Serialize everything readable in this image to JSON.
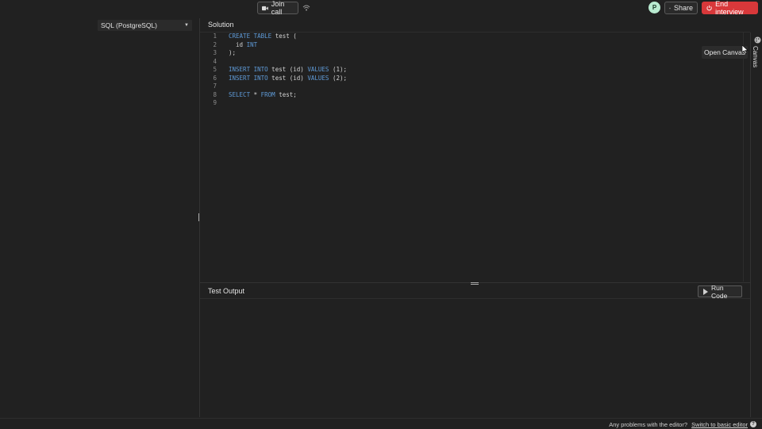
{
  "header": {
    "join_call_label": "Join call",
    "avatar_initial": "P",
    "share_label": "Share",
    "end_interview_label": "End interview"
  },
  "left_panel": {
    "language_selected": "SQL (PostgreSQL)"
  },
  "solution": {
    "title": "Solution",
    "line_numbers": [
      "1",
      "2",
      "3",
      "4",
      "5",
      "6",
      "7",
      "8",
      "9"
    ]
  },
  "canvas": {
    "label": "Canvas",
    "tooltip": "Open Canvas"
  },
  "test_output": {
    "title": "Test Output",
    "run_label": "Run Code"
  },
  "footer": {
    "prompt": "Any problems with the editor?",
    "link": "Switch to basic editor"
  },
  "colors": {
    "accent_end": "#d8383a",
    "keyword": "#5f9bd8",
    "background": "#212121"
  },
  "icons": {
    "join_call": "video-camera-icon",
    "signal": "wifi-signal-icon",
    "share": "link-icon",
    "end": "power-icon",
    "canvas": "palette-icon",
    "run": "play-icon",
    "help": "question-icon"
  }
}
